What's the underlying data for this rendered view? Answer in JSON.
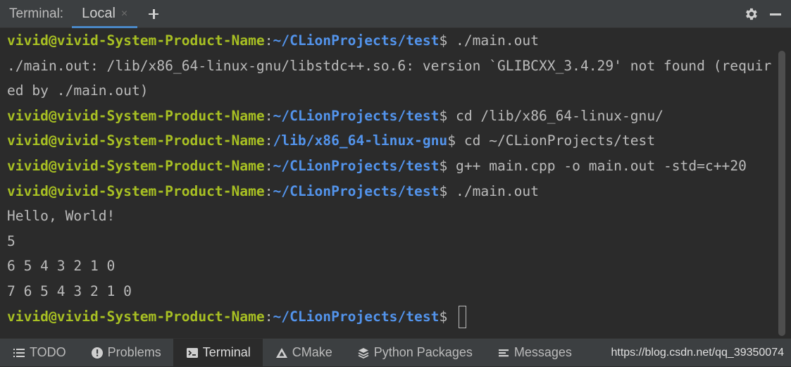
{
  "header": {
    "title": "Terminal:",
    "tab_label": "Local",
    "tab_close": "×"
  },
  "terminal": {
    "lines": [
      {
        "user": "vivid@vivid-System-Product-Name",
        "sep": ":",
        "path": "~/CLionProjects/test",
        "prompt": "$",
        "cmd": " ./main.out"
      },
      {
        "text": "./main.out: /lib/x86_64-linux-gnu/libstdc++.so.6: version `GLIBCXX_3.4.29' not found (requir"
      },
      {
        "text": "ed by ./main.out)"
      },
      {
        "user": "vivid@vivid-System-Product-Name",
        "sep": ":",
        "path": "~/CLionProjects/test",
        "prompt": "$",
        "cmd": " cd /lib/x86_64-linux-gnu/"
      },
      {
        "user": "vivid@vivid-System-Product-Name",
        "sep": ":",
        "path": "/lib/x86_64-linux-gnu",
        "prompt": "$",
        "cmd": " cd ~/CLionProjects/test"
      },
      {
        "user": "vivid@vivid-System-Product-Name",
        "sep": ":",
        "path": "~/CLionProjects/test",
        "prompt": "$",
        "cmd": " g++ main.cpp -o main.out -std=c++20"
      },
      {
        "user": "vivid@vivid-System-Product-Name",
        "sep": ":",
        "path": "~/CLionProjects/test",
        "prompt": "$",
        "cmd": " ./main.out"
      },
      {
        "text": "Hello, World!"
      },
      {
        "text": "5"
      },
      {
        "text": "6 5 4 3 2 1 0"
      },
      {
        "text": "7 6 5 4 3 2 1 0"
      },
      {
        "user": "vivid@vivid-System-Product-Name",
        "sep": ":",
        "path": "~/CLionProjects/test",
        "prompt": "$",
        "cmd": " "
      }
    ]
  },
  "statusbar": {
    "tools": [
      {
        "label": "TODO",
        "icon": "list-icon"
      },
      {
        "label": "Problems",
        "icon": "alert-icon"
      },
      {
        "label": "Terminal",
        "icon": "terminal-icon",
        "active": true
      },
      {
        "label": "CMake",
        "icon": "cmake-triangle-icon"
      },
      {
        "label": "Python Packages",
        "icon": "layers-icon"
      },
      {
        "label": "Messages",
        "icon": "messages-icon"
      }
    ],
    "watermark": "https://blog.csdn.net/qq_39350074"
  },
  "colors": {
    "background": "#2b2b2b",
    "panel": "#3c3f41",
    "user": "#a8c023",
    "path": "#5394ec",
    "text": "#bbbbbb",
    "accent": "#4a88c7"
  }
}
